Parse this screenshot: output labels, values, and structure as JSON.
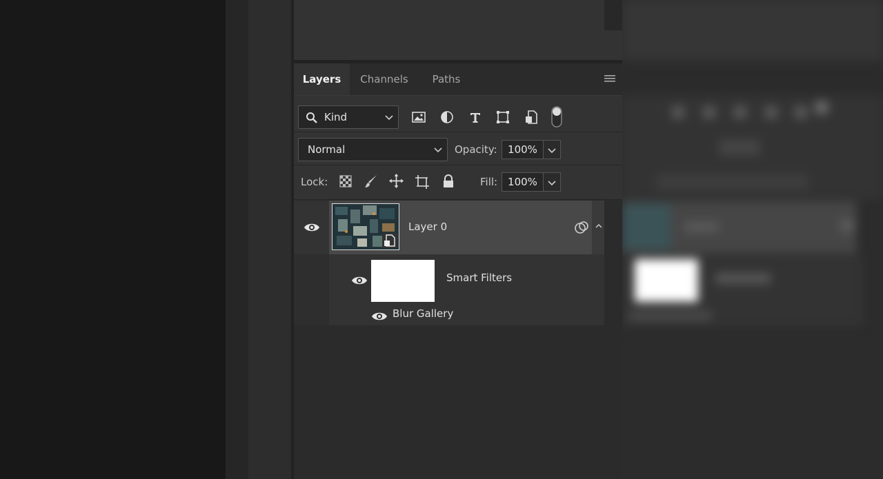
{
  "tabs": [
    {
      "label": "Layers",
      "active": true
    },
    {
      "label": "Channels",
      "active": false
    },
    {
      "label": "Paths",
      "active": false
    }
  ],
  "filter": {
    "kind_label": "Kind",
    "icons": [
      "image-filter-icon",
      "adjustment-filter-icon",
      "type-filter-icon",
      "shape-filter-icon",
      "smart-object-filter-icon",
      "filter-toggle-icon"
    ]
  },
  "blend": {
    "mode": "Normal",
    "opacity_label": "Opacity:",
    "opacity_value": "100%"
  },
  "lock": {
    "label": "Lock:",
    "icons": [
      "lock-transparent-pixels-icon",
      "lock-image-pixels-icon",
      "lock-position-icon",
      "lock-artboard-icon",
      "lock-all-icon"
    ],
    "fill_label": "Fill:",
    "fill_value": "100%"
  },
  "layers": [
    {
      "name": "Layer 0",
      "visible": true,
      "smart_object": true
    }
  ],
  "smart_filters": {
    "label": "Smart Filters",
    "filters": [
      {
        "name": "Blur Gallery"
      }
    ]
  },
  "colors": {
    "panel_bg": "#333333",
    "selected_row": "#484848",
    "text": "#e0e0e0"
  }
}
